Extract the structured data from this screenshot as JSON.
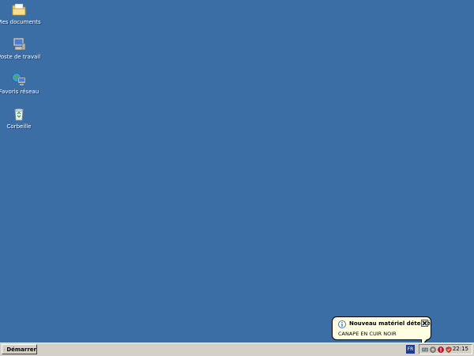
{
  "desktop": {
    "icons": [
      {
        "label": "Mes documents",
        "icon": "my-documents-icon"
      },
      {
        "label": "Poste de travail",
        "icon": "my-computer-icon"
      },
      {
        "label": "Favoris réseau",
        "icon": "network-places-icon"
      },
      {
        "label": "Corbeille",
        "icon": "recycle-bin-icon"
      }
    ],
    "background_color": "#3a6ea5"
  },
  "taskbar": {
    "start_label": "Démarrer",
    "language": "FR",
    "clock": "22:15",
    "tray_icons": [
      "safely-remove-hardware-icon",
      "volume-icon",
      "security-alert-icon",
      "shield-icon"
    ]
  },
  "balloon": {
    "title": "Nouveau matériel détecté",
    "message": "CANAPE EN CUIR NOIR",
    "icon": "info-icon"
  }
}
